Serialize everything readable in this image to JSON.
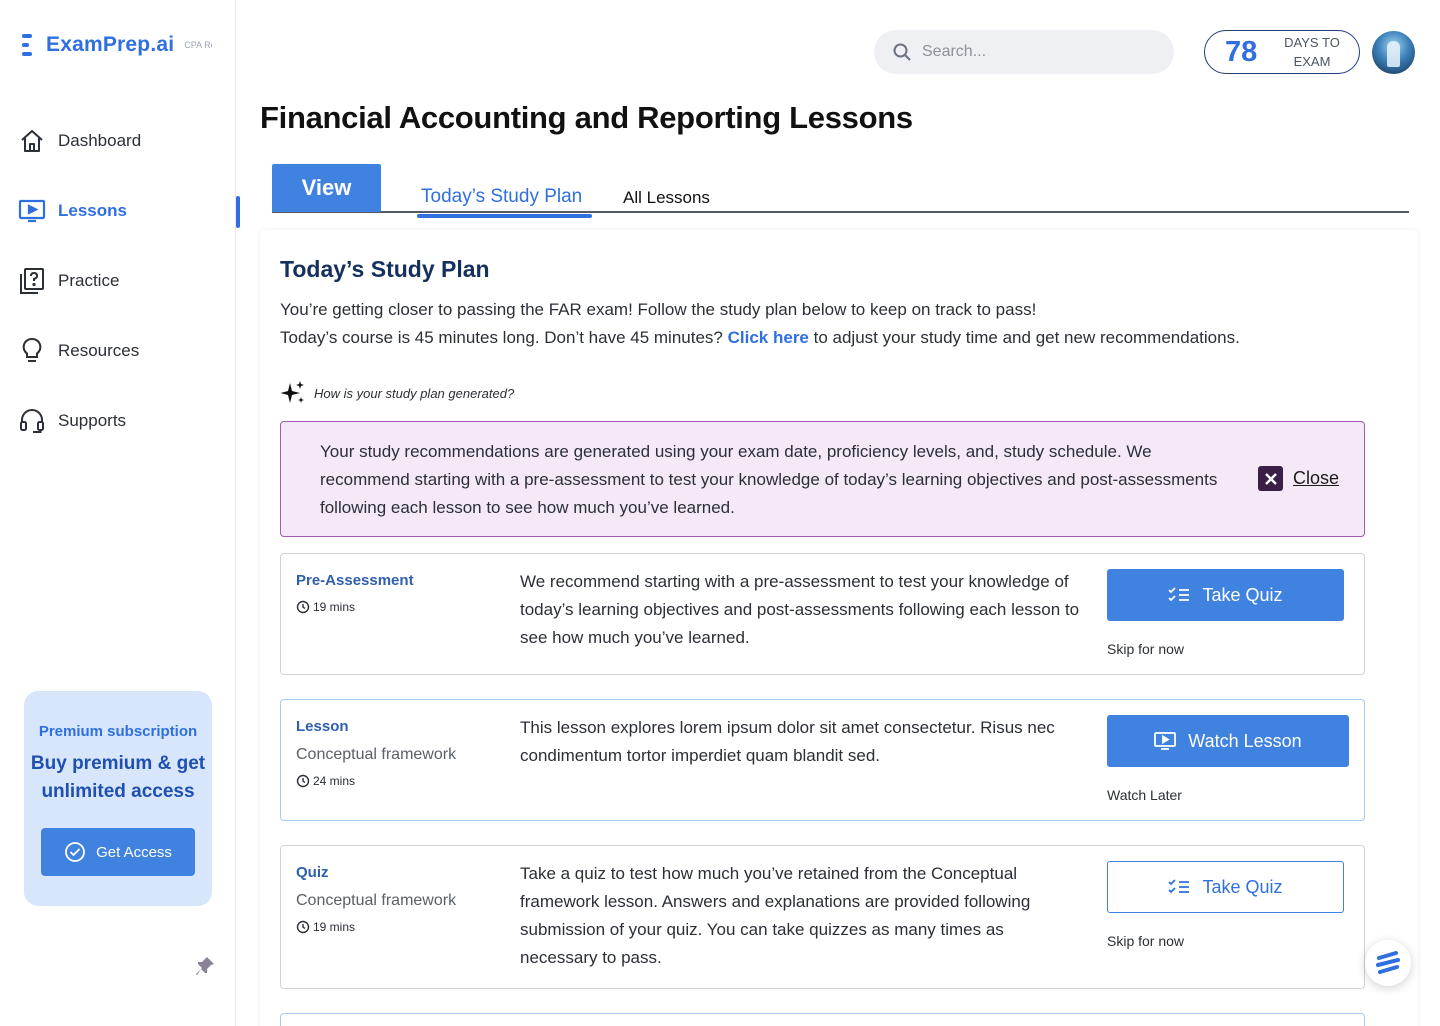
{
  "brand": {
    "name": "ExamPrep.ai",
    "tag": "CPA Review"
  },
  "sidebar": {
    "items": [
      {
        "label": "Dashboard",
        "icon": "home-icon",
        "active": false
      },
      {
        "label": "Lessons",
        "icon": "monitor-play-icon",
        "active": true
      },
      {
        "label": "Practice",
        "icon": "question-card-icon",
        "active": false
      },
      {
        "label": "Resources",
        "icon": "lightbulb-icon",
        "active": false
      },
      {
        "label": "Supports",
        "icon": "headset-icon",
        "active": false
      }
    ],
    "promo": {
      "eyebrow": "Premium subscription",
      "title": "Buy premium & get unlimited access",
      "button_label": "Get Access"
    }
  },
  "header": {
    "search_placeholder": "Search...",
    "days_count": "78",
    "days_label": "DAYS TO EXAM"
  },
  "page": {
    "title": "Financial Accounting and Reporting Lessons",
    "tabs": {
      "view": "View",
      "today": "Today’s Study Plan",
      "all": "All Lessons"
    }
  },
  "plan": {
    "title": "Today’s Study Plan",
    "intro_line1": "You’re getting closer to passing the FAR exam! Follow the study plan below to keep on track to pass!",
    "intro_line2_before": "Today’s course is 45 minutes long. Don’t have 45 minutes?",
    "intro_link": "Click here",
    "intro_line2_after": "to adjust your study time and get new recommendations.",
    "how_label": "How is your study plan generated?",
    "notice_text": "Your study recommendations are generated using your exam date, proficiency levels, and, study schedule. We recommend starting with a pre-assessment to test your knowledge of today’s learning objectives and post-assessments following each lesson to see how much you’ve learned.",
    "close_label": "Close",
    "items": [
      {
        "type": "Pre-Assessment",
        "subtitle": "",
        "duration": "19 mins",
        "description": "We recommend starting with a pre-assessment to test your knowledge of today’s learning objectives and post-assessments following each lesson to see how much you’ve learned.",
        "button_label": "Take Quiz",
        "button_icon": "checklist-icon",
        "secondary_label": "Skip for now"
      },
      {
        "type": "Lesson",
        "subtitle": "Conceptual framework",
        "duration": "24 mins",
        "description": "This lesson explores lorem ipsum dolor sit amet consectetur. Risus nec condimentum tortor imperdiet quam blandit sed.",
        "button_label": "Watch Lesson",
        "button_icon": "monitor-play-icon",
        "secondary_label": "Watch Later"
      },
      {
        "type": "Quiz",
        "subtitle": "Conceptual framework",
        "duration": "19 mins",
        "description": "Take a quiz to test how much you’ve retained from the Conceptual framework lesson. Answers and explanations are provided following submission of your quiz. You can take quizzes as many times as necessary to pass.",
        "button_label": "Take Quiz",
        "button_icon": "checklist-icon",
        "secondary_label": "Skip for now"
      }
    ]
  },
  "colors": {
    "brand_blue": "#2f6fe0",
    "button_blue": "#3f82e0",
    "notice_bg": "#f5e9f7",
    "notice_border": "#a45ab0",
    "promo_bg": "#d7e6fb"
  }
}
